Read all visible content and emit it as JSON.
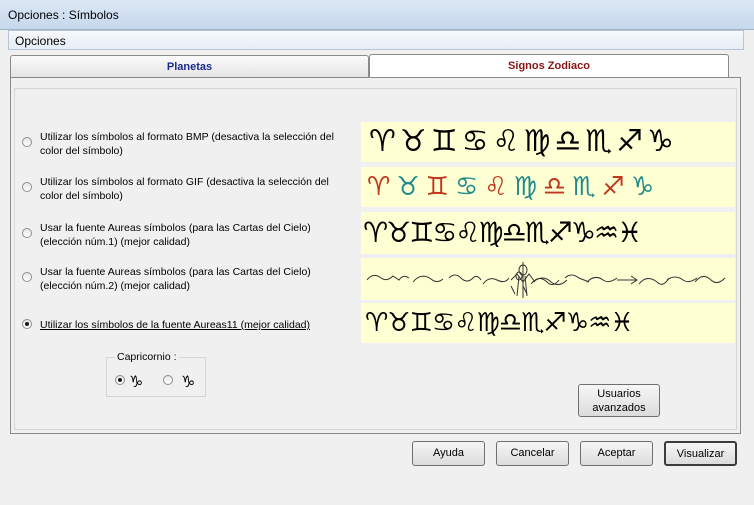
{
  "window": {
    "title": "Opciones : Símbolos"
  },
  "menu": {
    "item": "Opciones"
  },
  "tabs": {
    "planetas": "Planetas",
    "signos": "Signos Zodiaco"
  },
  "options": [
    {
      "label": "Utilizar los símbolos al formato BMP (desactiva la selección del color del símbolo)",
      "checked": false,
      "glyphs": "♈♉♊♋♌♍♎♏♐♑"
    },
    {
      "label": "Utilizar los símbolos al formato GIF (desactiva la selección del color del símbolo)",
      "checked": false,
      "glyphs": "♈♉♊♋♌♍♎♏♐♑"
    },
    {
      "label": "Usar la fuente Aureas símbolos (para las Cartas del Cielo) (elección núm.1) (mejor calidad)",
      "checked": false,
      "glyphs": "♈♉♊♋♌♍♎♏♐♑♒♓"
    },
    {
      "label": "Usar la fuente Aureas símbolos (para las Cartas del Cielo) (elección núm.2) (mejor calidad)",
      "checked": false,
      "glyphs": ""
    },
    {
      "label": "Utilizar los símbolos de la fuente Aureas11 (mejor calidad)",
      "checked": true,
      "glyphs": "♈♉♊♋♌♍♎♏♐♑♒♓"
    }
  ],
  "capricornio": {
    "legend": "Capricornio :",
    "opt1": "♑",
    "opt2": "♑",
    "selected": 1
  },
  "buttons": {
    "advanced_line1": "Usuarios",
    "advanced_line2": "avanzados",
    "help": "Ayuda",
    "cancel": "Cancelar",
    "accept": "Aceptar",
    "view": "Visualizar"
  },
  "colors": {
    "bmp_glyph": "#000000",
    "gif_glyph_red": "#c1361b",
    "gif_glyph_teal": "#1e8a8a",
    "strip_bg": "#ffffd4"
  }
}
